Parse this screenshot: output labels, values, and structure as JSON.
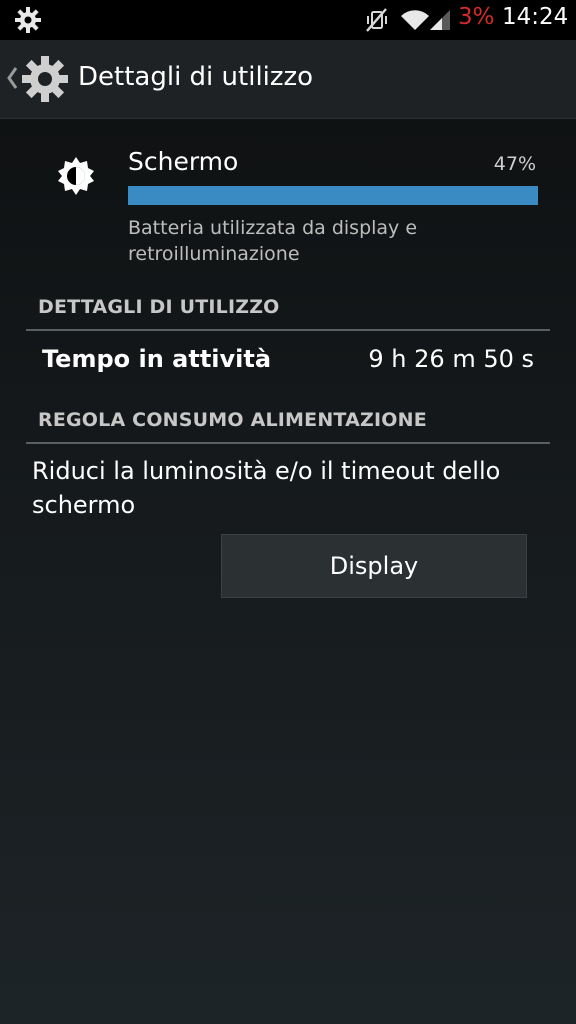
{
  "status_bar": {
    "settings_icon": "gear-icon",
    "mute_icon": "vibrate-mute-icon",
    "wifi_icon": "wifi-icon",
    "signal_icon": "signal-icon",
    "battery_text": "3%",
    "battery_color": "#d22b2b",
    "time": "14:24"
  },
  "action_bar": {
    "back_icon": "chevron-left-icon",
    "app_icon": "settings-gear-icon",
    "title": "Dettagli di utilizzo"
  },
  "usage_item": {
    "icon": "brightness-icon",
    "name": "Schermo",
    "percent_text": "47%",
    "percent_value": 100,
    "bar_color": "#3a8ac3",
    "description": "Batteria utilizzata da display e retroilluminazione"
  },
  "usage_details": {
    "header": "DETTAGLI DI UTILIZZO",
    "rows": [
      {
        "label": "Tempo in attività",
        "value": "9 h 26 m 50 s"
      }
    ]
  },
  "power_adjust": {
    "header": "REGOLA CONSUMO ALIMENTAZIONE",
    "tip": "Riduci la luminosità e/o il timeout dello schermo",
    "button_label": "Display"
  }
}
